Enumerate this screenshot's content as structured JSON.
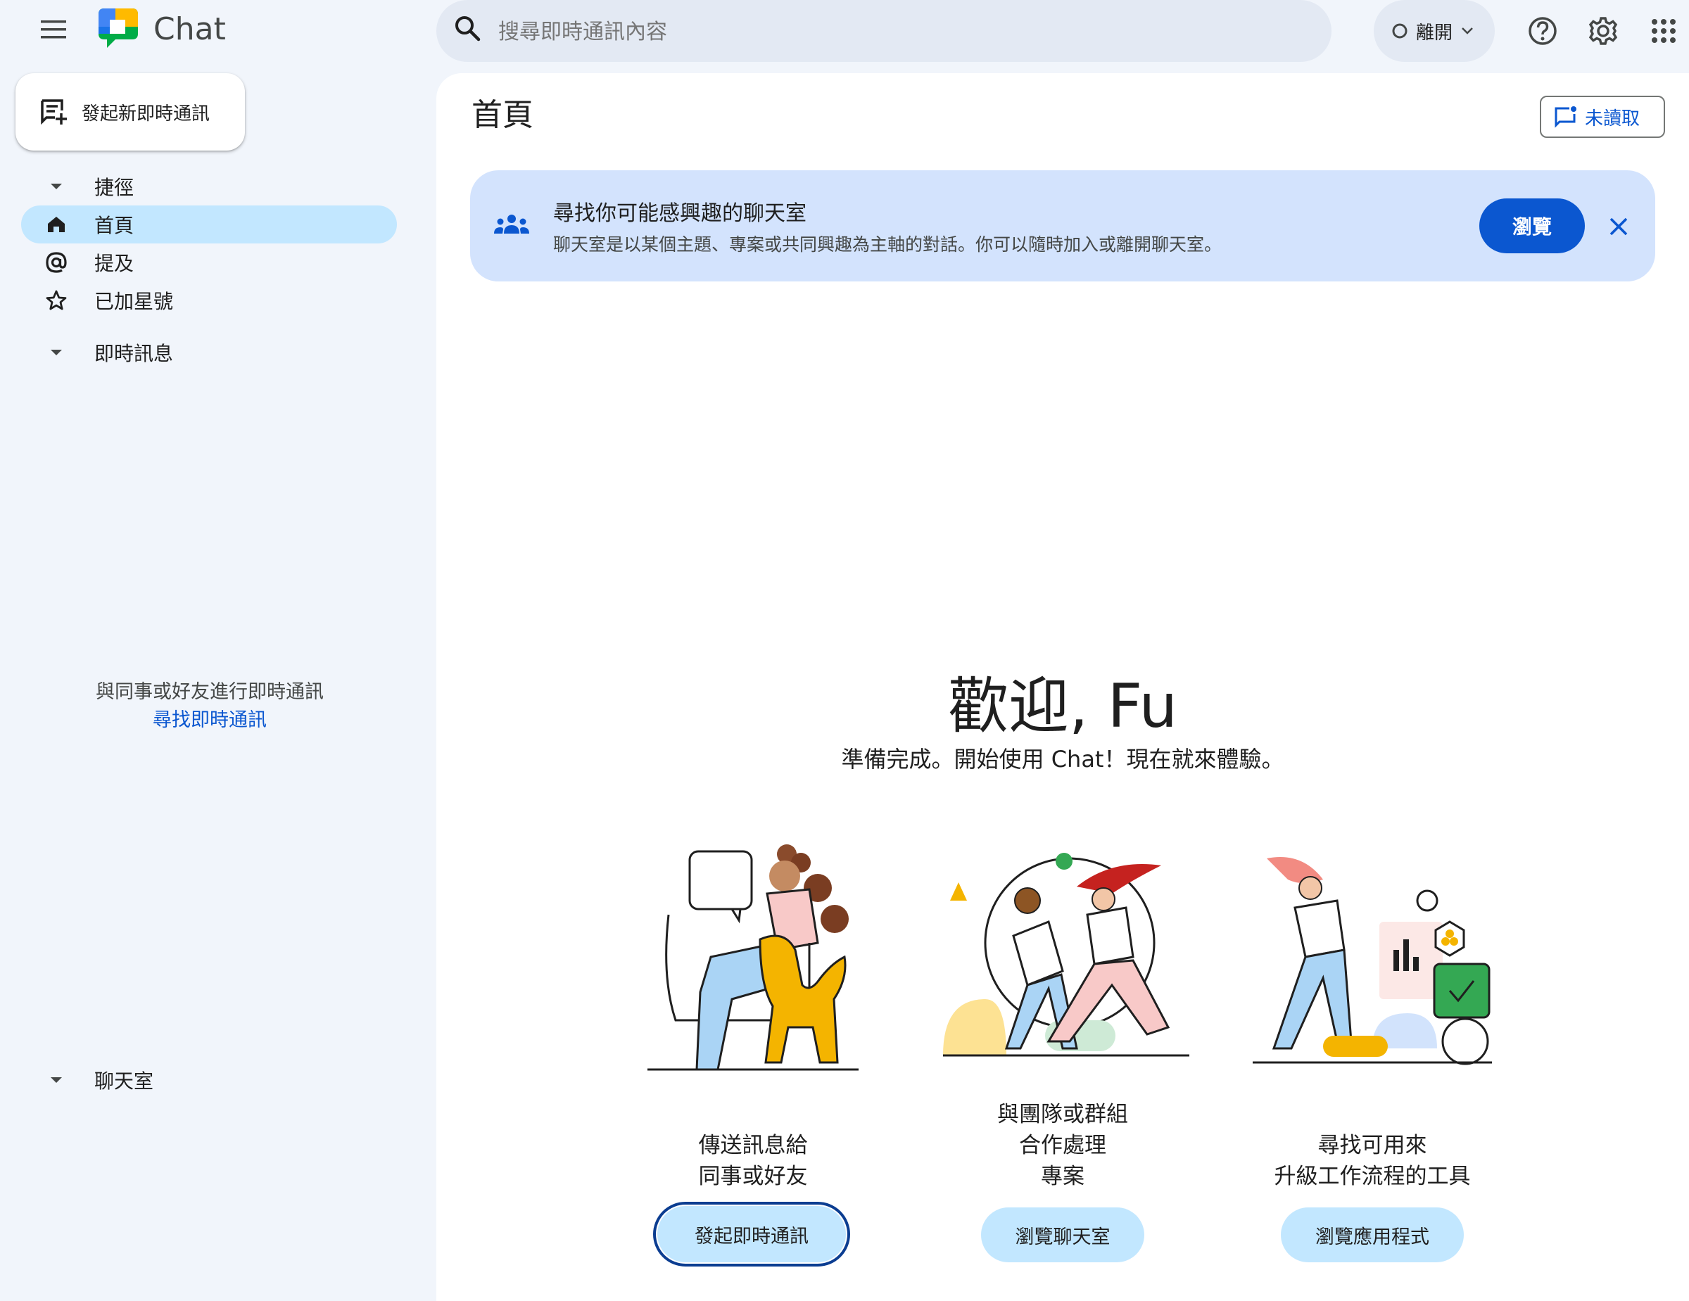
{
  "app": {
    "name": "Chat",
    "brand_colors": {
      "green": "#00ac47",
      "blue": "#4285f4",
      "yellow": "#ffba00",
      "red": "#ea4335"
    }
  },
  "search": {
    "placeholder": "搜尋即時通訊內容"
  },
  "status": {
    "label": "離開"
  },
  "header_icons": [
    "menu-icon",
    "search-icon",
    "help-icon",
    "settings-icon",
    "apps-grid-icon"
  ],
  "sidebar": {
    "new_chat_label": "發起新即時通訊",
    "shortcuts_label": "捷徑",
    "items": [
      {
        "label": "首頁",
        "icon": "home-icon",
        "active": true
      },
      {
        "label": "提及",
        "icon": "mention-icon",
        "active": false
      },
      {
        "label": "已加星號",
        "icon": "star-icon",
        "active": false
      }
    ],
    "dm_section_label": "即時訊息",
    "dm_empty_text": "與同事或好友進行即時通訊",
    "dm_empty_link": "尋找即時通訊",
    "spaces_section_label": "聊天室"
  },
  "main": {
    "title": "首頁",
    "unread_label": "未讀取",
    "banner": {
      "title": "尋找你可能感興趣的聊天室",
      "description": "聊天室是以某個主題、專案或共同興趣為主軸的對話。你可以隨時加入或離開聊天室。",
      "browse_label": "瀏覽"
    },
    "welcome_title": "歡迎, Fu",
    "welcome_subtitle": "準備完成。開始使用 Chat！現在就來體驗。",
    "cards": [
      {
        "lines": [
          "傳送訊息給",
          "同事或好友"
        ],
        "button": "發起即時通訊"
      },
      {
        "lines": [
          "與團隊或群組",
          "合作處理",
          "專案"
        ],
        "button": "瀏覽聊天室"
      },
      {
        "lines": [
          "尋找可用來",
          "升級工作流程的工具"
        ],
        "button": "瀏覽應用程式"
      }
    ]
  }
}
